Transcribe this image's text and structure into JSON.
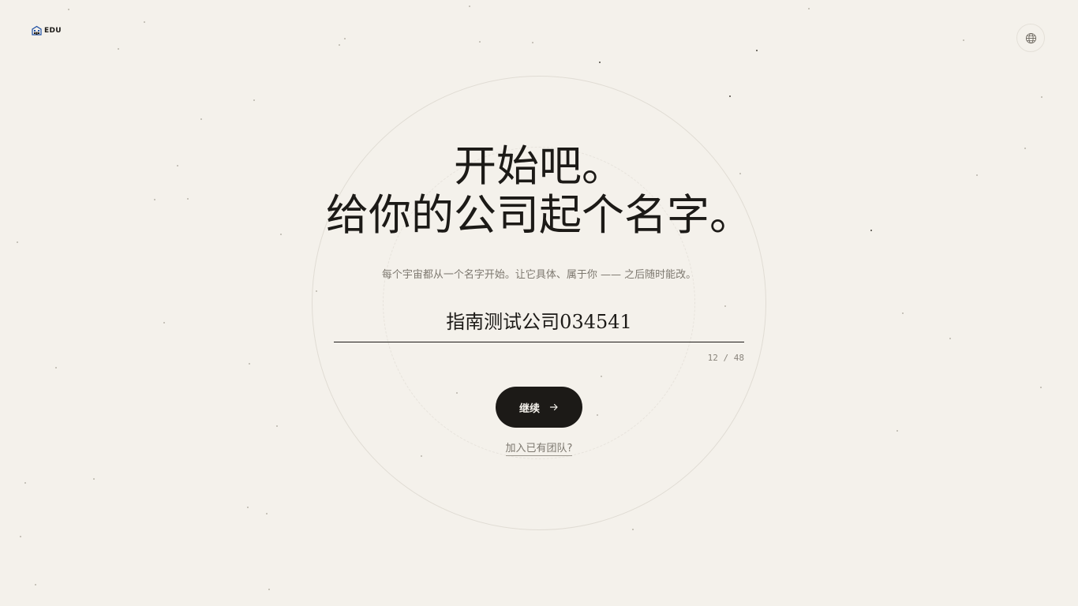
{
  "brand": {
    "logo_text": "EDU",
    "logo_icon": "building-icon"
  },
  "header": {
    "language_icon": "globe-icon"
  },
  "main": {
    "headline_line1": "开始吧。",
    "headline_line2": "给你的公司起个名字。",
    "subtitle": "每个宇宙都从一个名字开始。让它具体、属于你 —— 之后随时能改。",
    "company_name": {
      "value": "指南测试公司034541",
      "counter": "12 / 48"
    },
    "continue_label": "继续",
    "continue_icon": "arrow-right-icon",
    "join_link": "加入已有团队?"
  },
  "colors": {
    "background": "#f4f1eb",
    "text": "#1c1a17",
    "muted": "#7d786f",
    "button": "#1c1a17"
  }
}
